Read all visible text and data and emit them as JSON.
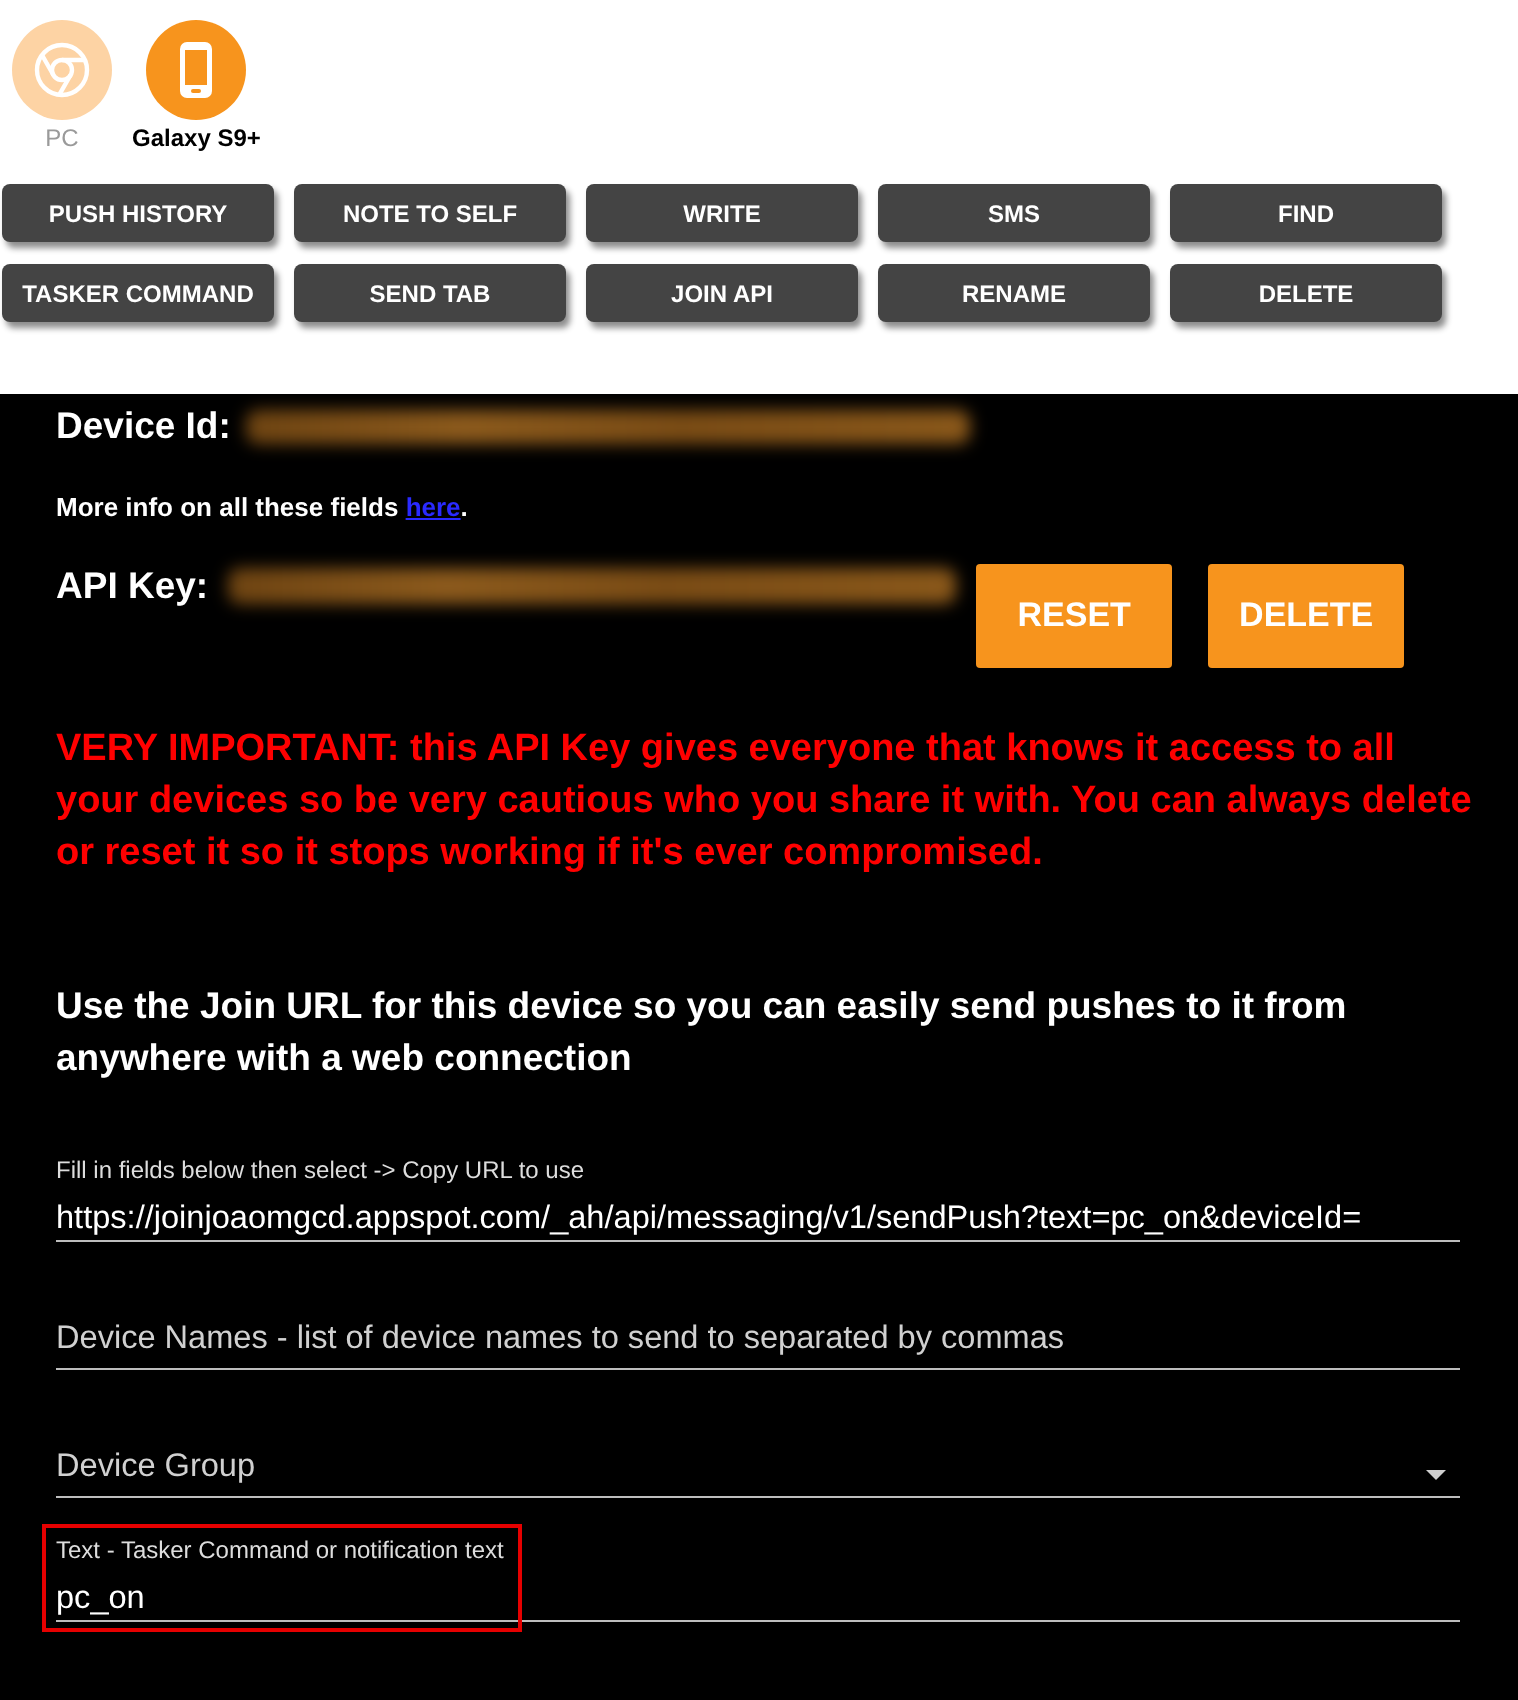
{
  "devices": [
    {
      "name": "PC",
      "kind": "browser",
      "selected": false
    },
    {
      "name": "Galaxy S9+",
      "kind": "phone",
      "selected": true
    }
  ],
  "actions": [
    "PUSH HISTORY",
    "NOTE TO SELF",
    "WRITE",
    "SMS",
    "FIND",
    "TASKER COMMAND",
    "SEND TAB",
    "JOIN API",
    "RENAME",
    "DELETE"
  ],
  "device_id": {
    "label": "Device Id:"
  },
  "info": {
    "text": "More info on all these fields",
    "link": "here",
    "suffix": "."
  },
  "api_key": {
    "label": "API Key:",
    "buttons": [
      "RESET",
      "DELETE"
    ]
  },
  "warning": "VERY IMPORTANT: this API Key gives everyone that knows it access to all your devices so be very cautious who you share it with. You can always delete or reset it so it stops working if it's ever compromised.",
  "heading": "Use the Join URL for this device so you can easily send pushes to it from anywhere with a web connection",
  "fields": [
    {
      "kind": "input",
      "label": "Fill in fields below then select -> Copy URL to use",
      "value": "https://joinjoaomgcd.appspot.com/_ah/api/messaging/v1/sendPush?text=pc_on&deviceId=",
      "highlighted": false
    },
    {
      "kind": "input",
      "placeholder": "Device Names - list of device names to send to separated by commas",
      "highlighted": false
    },
    {
      "kind": "select",
      "placeholder": "Device Group",
      "highlighted": false
    },
    {
      "kind": "input",
      "label": "Text - Tasker Command or notification text",
      "value": "pc_on",
      "highlighted": true
    }
  ]
}
